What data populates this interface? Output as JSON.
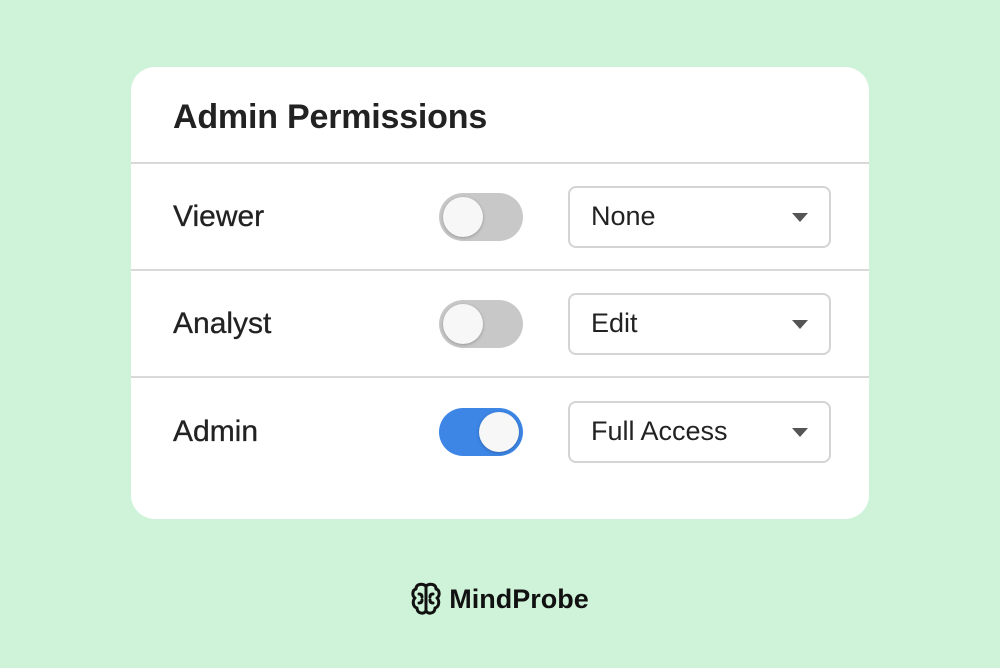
{
  "panel": {
    "title": "Admin Permissions",
    "rows": [
      {
        "label": "Viewer",
        "toggle_on": false,
        "access": "None"
      },
      {
        "label": "Analyst",
        "toggle_on": false,
        "access": "Edit"
      },
      {
        "label": "Admin",
        "toggle_on": true,
        "access": "Full Access"
      }
    ]
  },
  "footer": {
    "brand_name": "MindProbe",
    "brand_icon": "brain-icon"
  },
  "colors": {
    "background": "#cff3d8",
    "toggle_on": "#3d86e6",
    "toggle_off": "#c8c8c8"
  }
}
